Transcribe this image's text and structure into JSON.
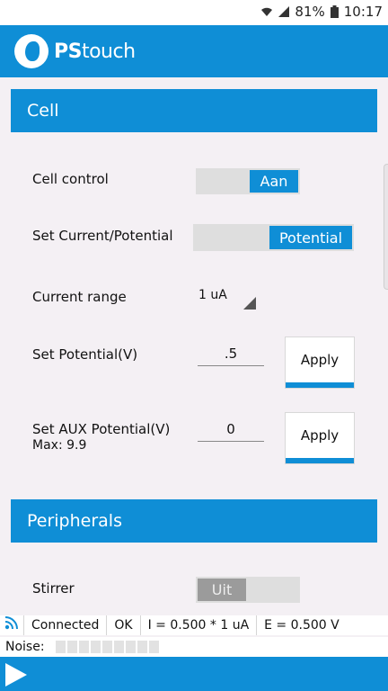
{
  "status_bar": {
    "battery_percent": "81%",
    "time": "10:17",
    "icons": [
      "wifi-icon",
      "signal-icon",
      "battery-icon"
    ]
  },
  "app": {
    "logo_bold": "PS",
    "logo_light": "touch"
  },
  "cell_section": {
    "title": "Cell",
    "cell_control": {
      "label": "Cell control",
      "toggle_value": "Aan"
    },
    "set_mode": {
      "label": "Set Current/Potential",
      "toggle_value": "Potential"
    },
    "current_range": {
      "label": "Current range",
      "value": "1 uA"
    },
    "set_potential": {
      "label": "Set Potential(V)",
      "value": ".5",
      "button": "Apply"
    },
    "set_aux": {
      "label": "Set AUX Potential(V)",
      "max": "Max: 9.9",
      "value": "0",
      "button": "Apply"
    }
  },
  "peripherals_section": {
    "title": "Peripherals",
    "stirrer": {
      "label": "Stirrer",
      "toggle_value": "Uit"
    }
  },
  "status_line": {
    "connection": "Connected",
    "state": "OK",
    "current": "I = 0.500 * 1 uA",
    "potential": "E = 0.500 V"
  },
  "noise": {
    "label": "Noise:",
    "segments": 9
  },
  "colors": {
    "accent": "#0f8ed6",
    "background": "#f4f0f4"
  }
}
